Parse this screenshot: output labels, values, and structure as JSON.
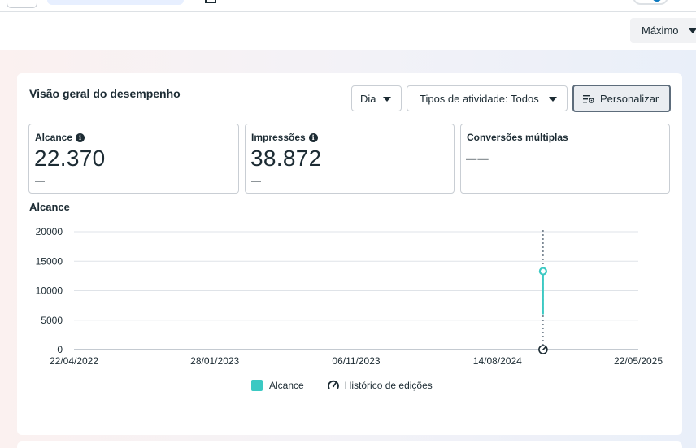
{
  "toolbar": {
    "range_button": "Máximo"
  },
  "card": {
    "title": "Visão geral do desempenho",
    "period_button": "Dia",
    "activity_types_button": "Tipos de atividade: Todos",
    "customize_button": "Personalizar"
  },
  "metrics": [
    {
      "label": "Alcance",
      "value": "22.370",
      "sub": "—",
      "has_info": true
    },
    {
      "label": "Impressões",
      "value": "38.872",
      "sub": "—",
      "has_info": true
    },
    {
      "label": "Conversões múltiplas",
      "value": "––",
      "sub": "",
      "has_info": false
    }
  ],
  "chart_section": {
    "title": "Alcance"
  },
  "colors": {
    "series": "#3bc9c3",
    "accent": "#0a78be",
    "text": "#1c2b33"
  },
  "chart_data": {
    "type": "line",
    "title": "Alcance",
    "xlabel": "",
    "ylabel": "",
    "x_ticks": [
      "22/04/2022",
      "28/01/2023",
      "06/11/2023",
      "14/08/2024",
      "22/05/2025"
    ],
    "xlim": [
      "22/04/2022",
      "22/05/2025"
    ],
    "y_ticks": [
      0,
      5000,
      10000,
      15000,
      20000
    ],
    "ylim": [
      0,
      20000
    ],
    "grid": true,
    "legend_position": "bottom-center",
    "series": [
      {
        "name": "Alcance",
        "color": "#3bc9c3",
        "points": [
          {
            "x": "13/11/2024",
            "y": 13300
          },
          {
            "x": "13/11/2024",
            "y": 6000
          }
        ]
      }
    ],
    "edit_history_markers": [
      {
        "x": "13/11/2024"
      }
    ],
    "legend": [
      "Alcance",
      "Histórico de edições"
    ]
  }
}
